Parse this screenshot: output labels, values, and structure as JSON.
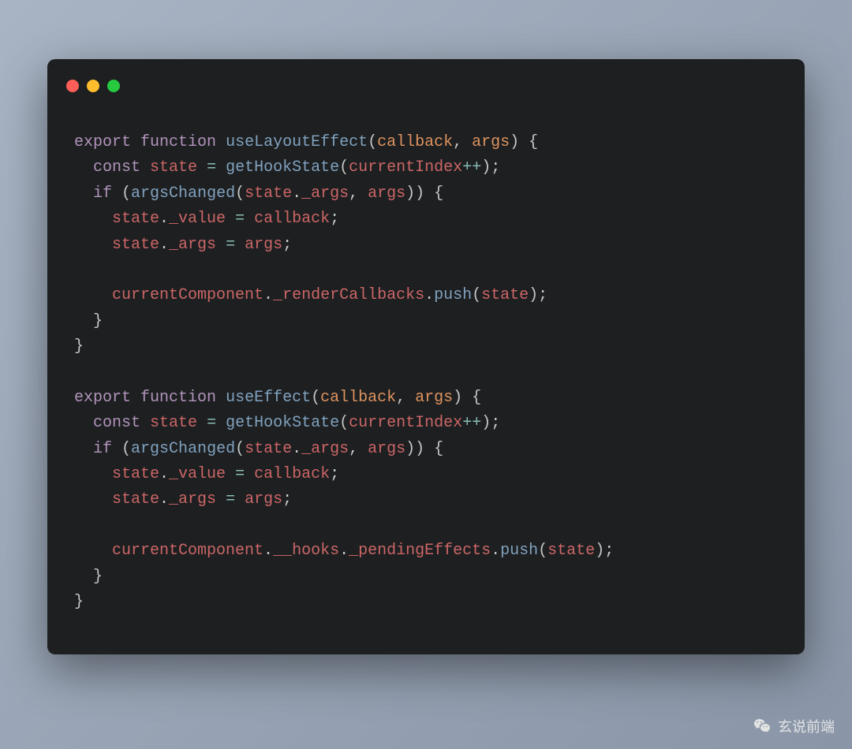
{
  "watermark": {
    "label": "玄说前端"
  },
  "code": {
    "tokens": [
      [
        [
          "kw",
          "export"
        ],
        [
          "pn",
          " "
        ],
        [
          "kw",
          "function"
        ],
        [
          "pn",
          " "
        ],
        [
          "fn",
          "useLayoutEffect"
        ],
        [
          "pn",
          "("
        ],
        [
          "prm",
          "callback"
        ],
        [
          "pn",
          ", "
        ],
        [
          "prm",
          "args"
        ],
        [
          "pn",
          ") {"
        ]
      ],
      [
        [
          "pn",
          "  "
        ],
        [
          "kw",
          "const"
        ],
        [
          "pn",
          " "
        ],
        [
          "id",
          "state"
        ],
        [
          "pn",
          " "
        ],
        [
          "op",
          "="
        ],
        [
          "pn",
          " "
        ],
        [
          "fn",
          "getHookState"
        ],
        [
          "pn",
          "("
        ],
        [
          "id",
          "currentIndex"
        ],
        [
          "op",
          "++"
        ],
        [
          "pn",
          ");"
        ]
      ],
      [
        [
          "pn",
          "  "
        ],
        [
          "kw",
          "if"
        ],
        [
          "pn",
          " ("
        ],
        [
          "fn",
          "argsChanged"
        ],
        [
          "pn",
          "("
        ],
        [
          "id",
          "state"
        ],
        [
          "pn",
          "."
        ],
        [
          "id",
          "_args"
        ],
        [
          "pn",
          ", "
        ],
        [
          "id",
          "args"
        ],
        [
          "pn",
          ")) {"
        ]
      ],
      [
        [
          "pn",
          "    "
        ],
        [
          "id",
          "state"
        ],
        [
          "pn",
          "."
        ],
        [
          "id",
          "_value"
        ],
        [
          "pn",
          " "
        ],
        [
          "op",
          "="
        ],
        [
          "pn",
          " "
        ],
        [
          "id",
          "callback"
        ],
        [
          "pn",
          ";"
        ]
      ],
      [
        [
          "pn",
          "    "
        ],
        [
          "id",
          "state"
        ],
        [
          "pn",
          "."
        ],
        [
          "id",
          "_args"
        ],
        [
          "pn",
          " "
        ],
        [
          "op",
          "="
        ],
        [
          "pn",
          " "
        ],
        [
          "id",
          "args"
        ],
        [
          "pn",
          ";"
        ]
      ],
      [
        [
          "pn",
          ""
        ]
      ],
      [
        [
          "pn",
          "    "
        ],
        [
          "id",
          "currentComponent"
        ],
        [
          "pn",
          "."
        ],
        [
          "id",
          "_renderCallbacks"
        ],
        [
          "pn",
          "."
        ],
        [
          "fn",
          "push"
        ],
        [
          "pn",
          "("
        ],
        [
          "id",
          "state"
        ],
        [
          "pn",
          ");"
        ]
      ],
      [
        [
          "pn",
          "  }"
        ]
      ],
      [
        [
          "pn",
          "}"
        ]
      ],
      [
        [
          "pn",
          ""
        ]
      ],
      [
        [
          "kw",
          "export"
        ],
        [
          "pn",
          " "
        ],
        [
          "kw",
          "function"
        ],
        [
          "pn",
          " "
        ],
        [
          "fn",
          "useEffect"
        ],
        [
          "pn",
          "("
        ],
        [
          "prm",
          "callback"
        ],
        [
          "pn",
          ", "
        ],
        [
          "prm",
          "args"
        ],
        [
          "pn",
          ") {"
        ]
      ],
      [
        [
          "pn",
          "  "
        ],
        [
          "kw",
          "const"
        ],
        [
          "pn",
          " "
        ],
        [
          "id",
          "state"
        ],
        [
          "pn",
          " "
        ],
        [
          "op",
          "="
        ],
        [
          "pn",
          " "
        ],
        [
          "fn",
          "getHookState"
        ],
        [
          "pn",
          "("
        ],
        [
          "id",
          "currentIndex"
        ],
        [
          "op",
          "++"
        ],
        [
          "pn",
          ");"
        ]
      ],
      [
        [
          "pn",
          "  "
        ],
        [
          "kw",
          "if"
        ],
        [
          "pn",
          " ("
        ],
        [
          "fn",
          "argsChanged"
        ],
        [
          "pn",
          "("
        ],
        [
          "id",
          "state"
        ],
        [
          "pn",
          "."
        ],
        [
          "id",
          "_args"
        ],
        [
          "pn",
          ", "
        ],
        [
          "id",
          "args"
        ],
        [
          "pn",
          ")) {"
        ]
      ],
      [
        [
          "pn",
          "    "
        ],
        [
          "id",
          "state"
        ],
        [
          "pn",
          "."
        ],
        [
          "id",
          "_value"
        ],
        [
          "pn",
          " "
        ],
        [
          "op",
          "="
        ],
        [
          "pn",
          " "
        ],
        [
          "id",
          "callback"
        ],
        [
          "pn",
          ";"
        ]
      ],
      [
        [
          "pn",
          "    "
        ],
        [
          "id",
          "state"
        ],
        [
          "pn",
          "."
        ],
        [
          "id",
          "_args"
        ],
        [
          "pn",
          " "
        ],
        [
          "op",
          "="
        ],
        [
          "pn",
          " "
        ],
        [
          "id",
          "args"
        ],
        [
          "pn",
          ";"
        ]
      ],
      [
        [
          "pn",
          ""
        ]
      ],
      [
        [
          "pn",
          "    "
        ],
        [
          "id",
          "currentComponent"
        ],
        [
          "pn",
          "."
        ],
        [
          "id",
          "__hooks"
        ],
        [
          "pn",
          "."
        ],
        [
          "id",
          "_pendingEffects"
        ],
        [
          "pn",
          "."
        ],
        [
          "fn",
          "push"
        ],
        [
          "pn",
          "("
        ],
        [
          "id",
          "state"
        ],
        [
          "pn",
          ");"
        ]
      ],
      [
        [
          "pn",
          "  }"
        ]
      ],
      [
        [
          "pn",
          "}"
        ]
      ]
    ]
  }
}
